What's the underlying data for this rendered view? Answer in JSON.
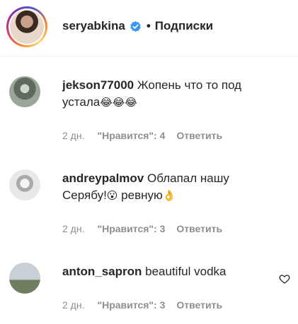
{
  "header": {
    "username": "seryabkina",
    "separator": "•",
    "follow_label": "Подписки"
  },
  "comments": [
    {
      "username": "jekson77000",
      "text_line1": "Жопень что то под",
      "text_line2": "устала",
      "emojis": "😂😂😂",
      "time": "2 дн.",
      "likes": "\"Нравится\": 4",
      "reply": "Ответить"
    },
    {
      "username": "andreypalmov",
      "text_line1": "Облапал нашу",
      "text_line2": "Серябу!",
      "emoji1": "😮",
      "text_after": "ревную",
      "emoji2": "👌",
      "time": "2 дн.",
      "likes": "\"Нравится\": 3",
      "reply": "Ответить"
    },
    {
      "username": "anton_sapron",
      "text_line1": "beautiful vodka",
      "time": "2 дн.",
      "likes": "\"Нравится\": 3",
      "reply": "Ответить"
    }
  ],
  "icons": {
    "verified": "verified-badge-icon",
    "like": "heart-outline-icon",
    "verified_color": "#3897f0"
  }
}
